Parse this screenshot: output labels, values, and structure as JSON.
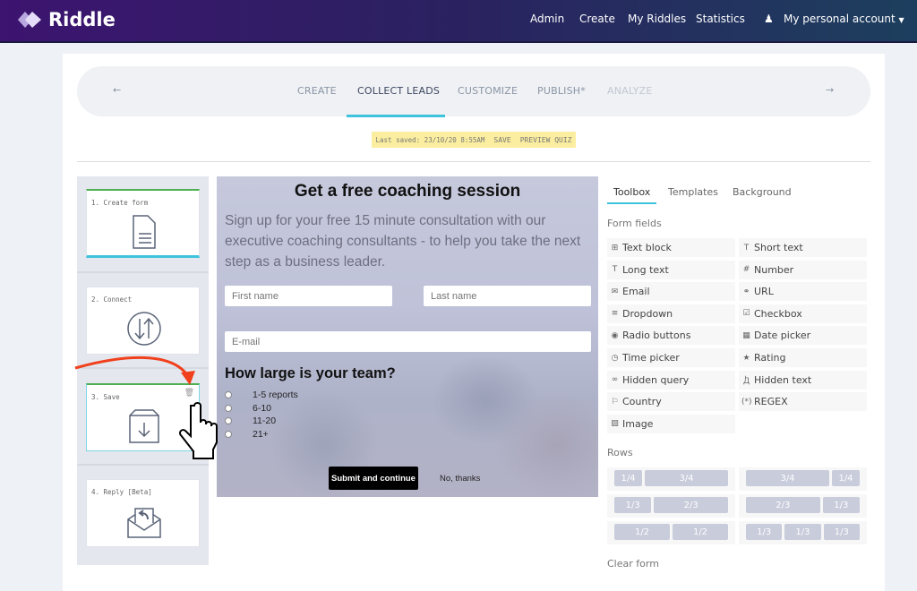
{
  "header": {
    "brand": "Riddle",
    "nav": [
      "Admin",
      "Create",
      "My Riddles",
      "Statistics"
    ],
    "account": "My personal account"
  },
  "steps": {
    "tabs": [
      "CREATE",
      "COLLECT LEADS",
      "CUSTOMIZE",
      "PUBLISH*",
      "ANALYZE"
    ],
    "active": "COLLECT LEADS"
  },
  "saved": {
    "text": "Last saved: 23/10/20 8:55AM",
    "save": "SAVE",
    "preview": "PREVIEW QUIZ"
  },
  "pipeline": [
    {
      "label": "1. Create form",
      "icon": "document-icon"
    },
    {
      "label": "2. Connect",
      "icon": "sync-icon"
    },
    {
      "label": "3. Save",
      "icon": "archive-download-icon"
    },
    {
      "label": "4. Reply [Beta]",
      "icon": "envelope-reply-icon"
    }
  ],
  "form": {
    "title": "Get a free coaching session",
    "subtitle": "Sign up for your free 15 minute consultation with our executive coaching consultants - to help you take the next step as a business leader.",
    "first_name": "First name",
    "last_name": "Last name",
    "email": "E-mail",
    "question": "How large is your team?",
    "options": [
      "1-5 reports",
      "6-10",
      "11-20",
      "21+"
    ],
    "submit": "Submit and continue",
    "decline": "No, thanks"
  },
  "toolbox": {
    "tabs": [
      "Toolbox",
      "Templates",
      "Background"
    ],
    "form_fields_label": "Form fields",
    "fields": [
      [
        "Text block",
        "⊞"
      ],
      [
        "Short text",
        "T"
      ],
      [
        "Long text",
        "T"
      ],
      [
        "Number",
        "#"
      ],
      [
        "Email",
        "✉"
      ],
      [
        "URL",
        "⚭"
      ],
      [
        "Dropdown",
        "≡"
      ],
      [
        "Checkbox",
        "☑"
      ],
      [
        "Radio buttons",
        "◉"
      ],
      [
        "Date picker",
        "▦"
      ],
      [
        "Time picker",
        "◷"
      ],
      [
        "Rating",
        "★"
      ],
      [
        "Hidden query",
        "∞"
      ],
      [
        "Hidden text",
        "Ꚁ"
      ],
      [
        "Country",
        "⚐"
      ],
      [
        "REGEX",
        "(*)"
      ],
      [
        "Image",
        "▨"
      ]
    ],
    "rows_label": "Rows",
    "rows": [
      [
        "1/4",
        "3/4"
      ],
      [
        "3/4",
        "1/4"
      ],
      [
        "1/3",
        "2/3"
      ],
      [
        "2/3",
        "1/3"
      ],
      [
        "1/2",
        "1/2"
      ],
      [
        "1/3",
        "1/3",
        "1/3"
      ]
    ],
    "clear_label": "Clear form"
  },
  "colors": {
    "accent": "#3ec3dc",
    "saved_bg": "#fbeea0",
    "complete": "#4caf50",
    "arrow": "#f0401c"
  }
}
